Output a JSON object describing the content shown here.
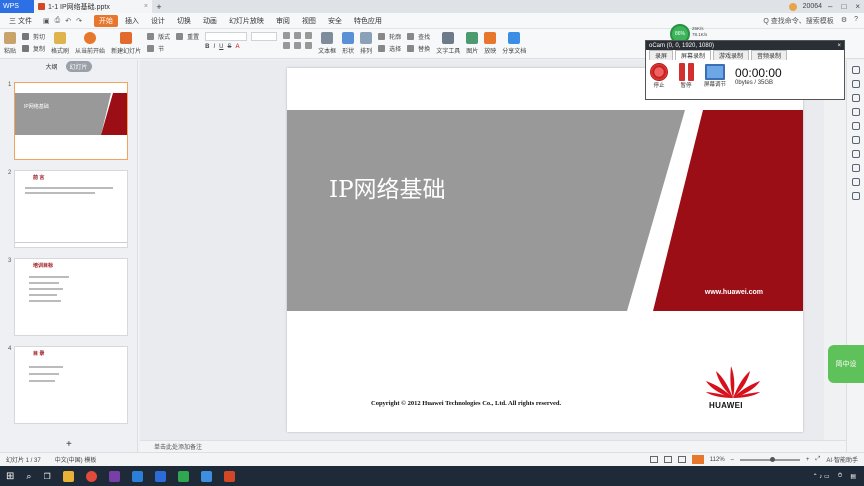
{
  "tabbar": {
    "app_label": "WPS",
    "doc_tab_label": "1-1 IP网络基础.pptx",
    "user_label": "20064"
  },
  "menubar": {
    "file_label": "三 文件",
    "items": [
      "开始",
      "插入",
      "设计",
      "切换",
      "动画",
      "幻灯片放映",
      "审阅",
      "视图",
      "安全",
      "特色应用"
    ],
    "active_index": 0,
    "search_label": "Q 查找命令、搜索模板"
  },
  "ribbon": {
    "paste_label": "粘贴",
    "cut_label": "剪切",
    "copy_label": "复制",
    "format_painter_label": "格式刷",
    "from_current_label": "从当前开始",
    "new_slide_label": "新建幻灯片",
    "layout_label": "版式",
    "section_label": "节",
    "reset_label": "重置",
    "textbox_label": "文本框",
    "shape_label": "形状",
    "arrange_label": "排列",
    "outline_label": "轮廓",
    "select_label": "选择",
    "find_label": "查找",
    "replace_label": "替换",
    "text_tools_label": "文字工具",
    "picture_label": "图片",
    "slide_show_label": "放映",
    "share_doc_label": "分享文档"
  },
  "leftpanel": {
    "tab_outline": "大纲",
    "tab_slides": "幻灯片",
    "slides": [
      {
        "num": "1",
        "title": "IP网络基础"
      },
      {
        "num": "2",
        "title": "前 言"
      },
      {
        "num": "3",
        "title": "培训目标"
      },
      {
        "num": "4",
        "title": "目 录"
      }
    ]
  },
  "slide": {
    "title": "IP网络基础",
    "url": "www.huawei.com",
    "copyright": "Copyright © 2012 Huawei Technologies Co., Ltd. All rights reserved.",
    "brand": "HUAWEI"
  },
  "ocam": {
    "title": "oCam (0, 0, 1920, 1080)",
    "tabs": [
      "录屏",
      "屏幕录制",
      "游戏录制",
      "音频录制"
    ],
    "active_tab": 1,
    "record_label": "停止",
    "pause_label": "暂停",
    "screen_label": "屏幕调节",
    "time": "00:00:00",
    "size": "0bytes / 35GB"
  },
  "badge": {
    "cpu": "86%",
    "up": "26K/s",
    "down": "78.1K/s"
  },
  "float_widget": {
    "label": "简中设"
  },
  "notes": {
    "placeholder": "单击此处添加备注"
  },
  "statusbar": {
    "slide_count": "幻灯片 1 / 37",
    "theme": "中文(中国) 模板",
    "zoom": "112%",
    "assistant": "AI·智能助手"
  },
  "colors": {
    "accent": "#e8772e",
    "huawei_red": "#9b0e16",
    "slide_gray": "#999999",
    "taskbar": "#1e2a38"
  }
}
